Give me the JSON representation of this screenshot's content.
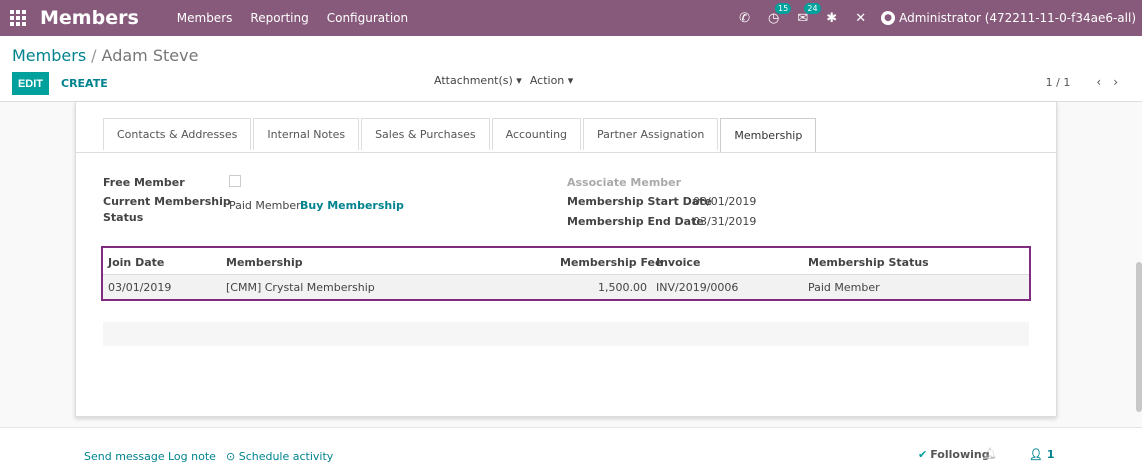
{
  "navbar": {
    "brand": "Members",
    "menu": [
      "Members",
      "Reporting",
      "Configuration"
    ],
    "badges": {
      "activities": "15",
      "messages": "24"
    },
    "user": "Administrator (472211-11-0-f34ae6-all)"
  },
  "control": {
    "breadcrumb_parent": "Members",
    "breadcrumb_sep": "/",
    "breadcrumb_current": "Adam Steve",
    "edit_label": "EDIT",
    "create_label": "CREATE",
    "attachments_label": "Attachment(s) ▾",
    "action_label": "Action ▾",
    "pager": "1 / 1",
    "prev_icon": "‹",
    "next_icon": "›"
  },
  "tabs": [
    "Contacts & Addresses",
    "Internal Notes",
    "Sales & Purchases",
    "Accounting",
    "Partner Assignation",
    "Membership"
  ],
  "active_tab": "Membership",
  "form": {
    "free_member_label": "Free Member",
    "current_status_label_1": "Current Membership",
    "current_status_label_2": "Status",
    "current_status_value": "Paid Member",
    "buy_membership": "Buy Membership",
    "associate_member_label": "Associate Member",
    "start_date_label": "Membership Start Date",
    "start_date_value": "03/01/2019",
    "end_date_label": "Membership End Date",
    "end_date_value": "03/31/2019"
  },
  "table": {
    "headers": [
      "Join Date",
      "Membership",
      "Membership Fee",
      "Invoice",
      "Membership Status"
    ],
    "rows": [
      [
        "03/01/2019",
        "[CMM] Crystal Membership",
        "1,500.00",
        "INV/2019/0006",
        "Paid Member"
      ]
    ]
  },
  "chatter": {
    "send_message": "Send message",
    "log_note": "Log note",
    "schedule_activity": "⊙ Schedule activity",
    "following": "Following",
    "followers_count": "1"
  },
  "colors": {
    "navbar": "#875a7b",
    "primary": "#00a09d",
    "link": "#00838f",
    "highlight_border": "#7e2b80"
  }
}
